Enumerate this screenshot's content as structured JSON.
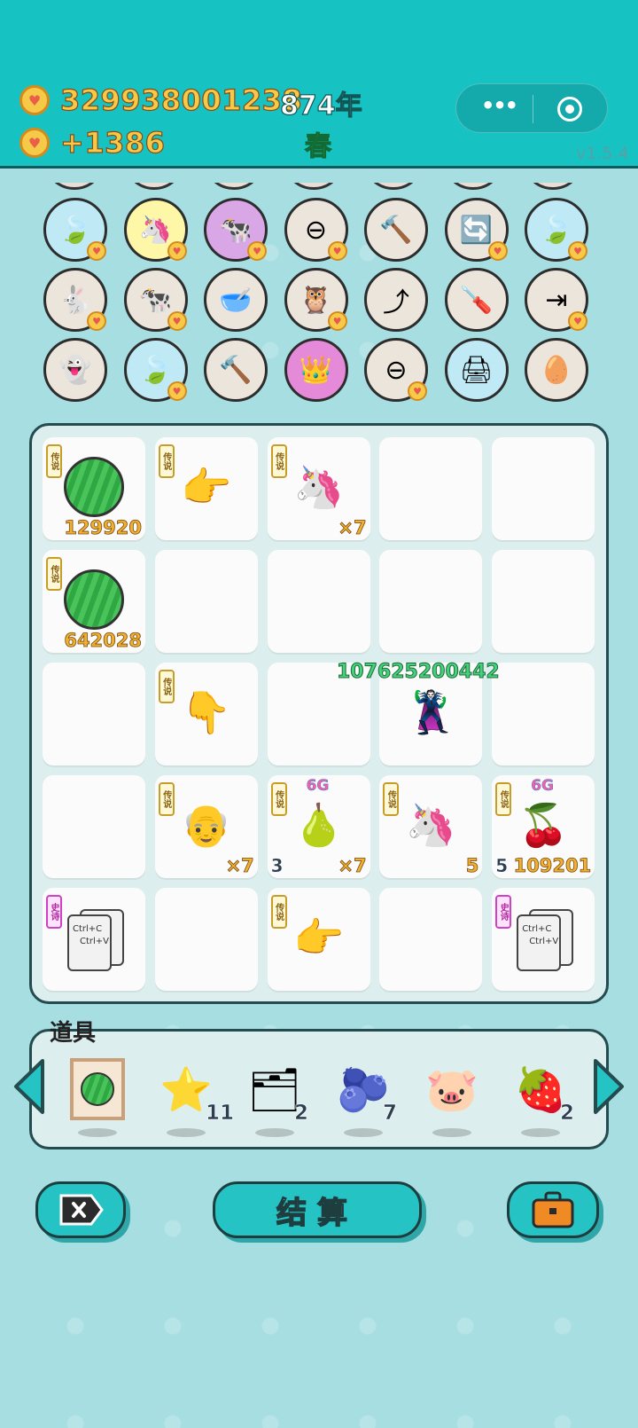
{
  "header": {
    "coins": "329938001238",
    "coins_gain": "+1386",
    "year": "874年",
    "season": "春",
    "version": "v1.5.4",
    "capsule_menu_icon": "more-dots-icon",
    "capsule_close_icon": "target-circle-icon"
  },
  "tools": [
    {
      "icon": "leaf-icon",
      "glyph": "🍃",
      "bg": "#bfe9f5",
      "badge": true
    },
    {
      "icon": "unicorn-icon",
      "glyph": "🦄",
      "bg": "#fff7a8",
      "badge": true
    },
    {
      "icon": "twin-cows-icon",
      "glyph": "🐄",
      "bg": "#d9a6e6",
      "badge": true
    },
    {
      "icon": "minus-circle-icon",
      "glyph": "⊖",
      "bg": "#ece5dc",
      "badge": true
    },
    {
      "icon": "hammer-icon",
      "glyph": "🔨",
      "bg": "#ece5dc",
      "badge": false
    },
    {
      "icon": "refresh-icon",
      "glyph": "🔄",
      "bg": "#ece5dc",
      "badge": true
    },
    {
      "icon": "leaf-icon",
      "glyph": "🍃",
      "bg": "#bfe9f5",
      "badge": true
    },
    {
      "icon": "rabbit-icon",
      "glyph": "🐇",
      "bg": "#ece5dc",
      "badge": true
    },
    {
      "icon": "twin-cows-icon",
      "glyph": "🐄",
      "bg": "#ece5dc",
      "badge": true
    },
    {
      "icon": "food-bowl-icon",
      "glyph": "🥣",
      "bg": "#ece5dc",
      "badge": false
    },
    {
      "icon": "owl-icon",
      "glyph": "🦉",
      "bg": "#ece5dc",
      "badge": true
    },
    {
      "icon": "curve-arrow-icon",
      "glyph": "⤴",
      "bg": "#ece5dc",
      "badge": false
    },
    {
      "icon": "screwdriver-icon",
      "glyph": "🪛",
      "bg": "#ece5dc",
      "badge": false
    },
    {
      "icon": "skip-icon",
      "glyph": "⇥",
      "bg": "#ece5dc",
      "badge": true
    },
    {
      "icon": "ghost-icon",
      "glyph": "👻",
      "bg": "#ece5dc",
      "badge": false
    },
    {
      "icon": "leaf-icon",
      "glyph": "🍃",
      "bg": "#bfe9f5",
      "badge": true
    },
    {
      "icon": "hammer-icon",
      "glyph": "🔨",
      "bg": "#ece5dc",
      "badge": false
    },
    {
      "icon": "crown-box-icon",
      "glyph": "👑",
      "bg": "#e48ad9",
      "badge": false
    },
    {
      "icon": "minus-circle-icon",
      "glyph": "⊖",
      "bg": "#ece5dc",
      "badge": true
    },
    {
      "icon": "printer-icon",
      "glyph": "🖨",
      "bg": "#bfe9f5",
      "badge": false
    },
    {
      "icon": "egg-tray-icon",
      "glyph": "🥚",
      "bg": "#ece5dc",
      "badge": false
    }
  ],
  "board": {
    "legend_label": "传说",
    "epic_label": "史诗",
    "robber_value": "107625200442",
    "cells": [
      {
        "tag": "legend",
        "item": "watermelon",
        "num": "129920"
      },
      {
        "tag": "legend",
        "item": "pointing-hand",
        "glyph": "👉"
      },
      {
        "tag": "legend",
        "item": "unicorn",
        "glyph": "🦄",
        "num": "×7"
      },
      {},
      {},
      {
        "tag": "legend",
        "item": "watermelon",
        "num": "642028"
      },
      {},
      {},
      {},
      {},
      {},
      {
        "tag": "legend",
        "item": "pointing-hand-down",
        "glyph": "👇"
      },
      {},
      {
        "item": "robber",
        "glyph": "🦹"
      },
      {},
      {},
      {
        "tag": "legend",
        "item": "old-man",
        "glyph": "👴",
        "num": "×7"
      },
      {
        "tag": "legend",
        "item": "pear",
        "glyph": "🍐",
        "num": "×7",
        "left": "3",
        "g": "6G"
      },
      {
        "tag": "legend",
        "item": "unicorn",
        "glyph": "🦄",
        "num": "5"
      },
      {
        "tag": "legend",
        "item": "cherries",
        "glyph": "🍒",
        "num": "109201",
        "left": "5",
        "g": "6G"
      },
      {
        "tag": "epic",
        "item": "copy-paste"
      },
      {},
      {
        "tag": "legend",
        "item": "pointing-hand",
        "glyph": "👉"
      },
      {},
      {
        "tag": "epic",
        "item": "copy-paste"
      }
    ],
    "copy_text_1": "Ctrl+C",
    "copy_text_2": "Ctrl+V"
  },
  "props": {
    "title": "道具",
    "items": [
      {
        "icon": "framed-melon-icon",
        "glyph": "🍉",
        "count": ""
      },
      {
        "icon": "star-icon",
        "glyph": "⭐",
        "count": "11"
      },
      {
        "icon": "legend-cards-icon",
        "glyph": "🗂",
        "count": "2"
      },
      {
        "icon": "blueberry-icon",
        "glyph": "🫐",
        "count": "7"
      },
      {
        "icon": "piggy-bank-icon",
        "glyph": "🐷",
        "count": ""
      },
      {
        "icon": "lychee-icon",
        "glyph": "🍓",
        "count": "2"
      }
    ]
  },
  "buttons": {
    "settle_label": "结算"
  }
}
